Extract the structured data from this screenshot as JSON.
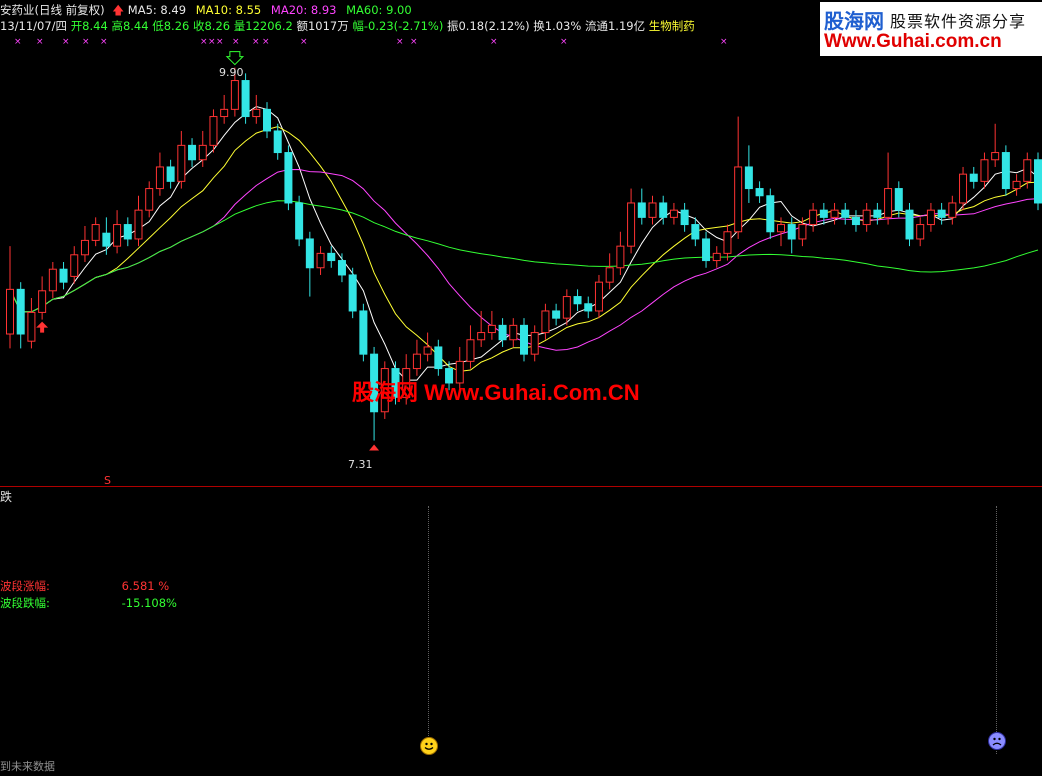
{
  "header": {
    "stock_name": "安药业(日线 前复权)",
    "date": "13/11/07/四",
    "open_label": "开8.44",
    "high_label": "高8.44",
    "low_label": "低8.26",
    "close_label": "收8.26",
    "volume_label": "量12206.2",
    "amount_label": "额1017万",
    "change_label": "幅-0.23(-2.71%)",
    "amplitude_label": "振0.18(2.12%)",
    "turnover_label": "换1.03%",
    "float_label": "流通1.19亿",
    "sector_label": "生物制药",
    "ma5": "MA5: 8.49",
    "ma10": "MA10: 8.55",
    "ma20": "MA20: 8.93",
    "ma60": "MA60: 9.00"
  },
  "logo": {
    "brand": "股海网",
    "slogan": "股票软件资源分享",
    "url": "Www.Guhai.com.cn"
  },
  "watermark": "股海网 Www.Guhai.Com.CN",
  "price_labels": {
    "high": "9.90",
    "low": "7.31"
  },
  "marker_s": "S",
  "indicator": {
    "title": "跌",
    "rise_label": "波段涨幅:",
    "rise_value": "6.581 %",
    "fall_label": "波段跌幅:",
    "fall_value": "-15.108%",
    "footer": "到未来数据"
  },
  "colors": {
    "up": "#ff3333",
    "down": "#33e5e5",
    "ma5": "#ffffff",
    "ma10": "#ffff33",
    "ma20": "#ff44ff",
    "ma60": "#33ff33"
  },
  "candles": [
    [
      8.05,
      8.36,
      8.66,
      7.95
    ],
    [
      8.36,
      8.05,
      8.41,
      7.95
    ],
    [
      8.0,
      8.2,
      8.3,
      7.95
    ],
    [
      8.2,
      8.35,
      8.45,
      8.15
    ],
    [
      8.35,
      8.5,
      8.55,
      8.3
    ],
    [
      8.5,
      8.41,
      8.55,
      8.36
    ],
    [
      8.45,
      8.6,
      8.66,
      8.4
    ],
    [
      8.6,
      8.7,
      8.8,
      8.55
    ],
    [
      8.7,
      8.81,
      8.86,
      8.66
    ],
    [
      8.75,
      8.66,
      8.86,
      8.6
    ],
    [
      8.66,
      8.81,
      8.91,
      8.61
    ],
    [
      8.81,
      8.71,
      8.86,
      8.66
    ],
    [
      8.71,
      8.91,
      9.01,
      8.66
    ],
    [
      8.91,
      9.06,
      9.11,
      8.86
    ],
    [
      9.06,
      9.21,
      9.31,
      9.01
    ],
    [
      9.21,
      9.11,
      9.26,
      9.06
    ],
    [
      9.11,
      9.36,
      9.46,
      9.06
    ],
    [
      9.36,
      9.26,
      9.41,
      9.21
    ],
    [
      9.26,
      9.36,
      9.46,
      9.21
    ],
    [
      9.36,
      9.56,
      9.61,
      9.31
    ],
    [
      9.56,
      9.61,
      9.71,
      9.51
    ],
    [
      9.61,
      9.81,
      9.9,
      9.56
    ],
    [
      9.81,
      9.56,
      9.86,
      9.51
    ],
    [
      9.56,
      9.61,
      9.71,
      9.51
    ],
    [
      9.61,
      9.46,
      9.66,
      9.41
    ],
    [
      9.46,
      9.31,
      9.51,
      9.26
    ],
    [
      9.31,
      8.96,
      9.36,
      8.91
    ],
    [
      8.96,
      8.71,
      9.01,
      8.66
    ],
    [
      8.71,
      8.51,
      8.76,
      8.31
    ],
    [
      8.51,
      8.61,
      8.66,
      8.46
    ],
    [
      8.61,
      8.56,
      8.66,
      8.51
    ],
    [
      8.56,
      8.46,
      8.61,
      8.41
    ],
    [
      8.46,
      8.21,
      8.51,
      8.16
    ],
    [
      8.21,
      7.91,
      8.26,
      7.86
    ],
    [
      7.91,
      7.51,
      7.96,
      7.31
    ],
    [
      7.51,
      7.81,
      7.86,
      7.46
    ],
    [
      7.81,
      7.61,
      7.86,
      7.56
    ],
    [
      7.61,
      7.81,
      7.91,
      7.56
    ],
    [
      7.81,
      7.91,
      8.01,
      7.76
    ],
    [
      7.91,
      7.96,
      8.06,
      7.86
    ],
    [
      7.96,
      7.81,
      8.01,
      7.76
    ],
    [
      7.81,
      7.71,
      7.86,
      7.66
    ],
    [
      7.71,
      7.86,
      7.96,
      7.66
    ],
    [
      7.86,
      8.01,
      8.11,
      7.81
    ],
    [
      8.01,
      8.06,
      8.21,
      7.96
    ],
    [
      8.06,
      8.11,
      8.21,
      8.01
    ],
    [
      8.11,
      8.01,
      8.16,
      7.96
    ],
    [
      8.01,
      8.11,
      8.16,
      7.96
    ],
    [
      8.11,
      7.91,
      8.16,
      7.86
    ],
    [
      7.91,
      8.06,
      8.11,
      7.86
    ],
    [
      8.06,
      8.21,
      8.26,
      8.01
    ],
    [
      8.21,
      8.16,
      8.26,
      8.11
    ],
    [
      8.16,
      8.31,
      8.36,
      8.11
    ],
    [
      8.31,
      8.26,
      8.36,
      8.21
    ],
    [
      8.26,
      8.21,
      8.31,
      8.16
    ],
    [
      8.21,
      8.41,
      8.46,
      8.16
    ],
    [
      8.41,
      8.51,
      8.61,
      8.36
    ],
    [
      8.51,
      8.66,
      8.76,
      8.46
    ],
    [
      8.66,
      8.96,
      9.06,
      8.61
    ],
    [
      8.96,
      8.86,
      9.06,
      8.81
    ],
    [
      8.86,
      8.96,
      9.01,
      8.81
    ],
    [
      8.96,
      8.86,
      9.01,
      8.81
    ],
    [
      8.86,
      8.91,
      8.96,
      8.81
    ],
    [
      8.91,
      8.81,
      8.96,
      8.76
    ],
    [
      8.81,
      8.71,
      8.86,
      8.66
    ],
    [
      8.71,
      8.56,
      8.76,
      8.51
    ],
    [
      8.56,
      8.61,
      8.66,
      8.51
    ],
    [
      8.61,
      8.76,
      8.81,
      8.56
    ],
    [
      8.76,
      9.21,
      9.56,
      8.71
    ],
    [
      9.21,
      9.06,
      9.36,
      8.96
    ],
    [
      9.06,
      9.01,
      9.11,
      8.96
    ],
    [
      9.01,
      8.76,
      9.06,
      8.71
    ],
    [
      8.76,
      8.81,
      8.86,
      8.66
    ],
    [
      8.81,
      8.71,
      8.86,
      8.61
    ],
    [
      8.71,
      8.81,
      8.86,
      8.66
    ],
    [
      8.81,
      8.91,
      8.96,
      8.76
    ],
    [
      8.91,
      8.86,
      8.96,
      8.81
    ],
    [
      8.86,
      8.91,
      8.96,
      8.81
    ],
    [
      8.91,
      8.86,
      8.96,
      8.81
    ],
    [
      8.86,
      8.81,
      8.91,
      8.76
    ],
    [
      8.81,
      8.91,
      8.96,
      8.76
    ],
    [
      8.91,
      8.86,
      8.96,
      8.81
    ],
    [
      8.86,
      9.06,
      9.31,
      8.81
    ],
    [
      9.06,
      8.91,
      9.11,
      8.86
    ],
    [
      8.91,
      8.71,
      8.96,
      8.66
    ],
    [
      8.71,
      8.81,
      8.86,
      8.66
    ],
    [
      8.81,
      8.91,
      8.96,
      8.76
    ],
    [
      8.91,
      8.86,
      8.96,
      8.81
    ],
    [
      8.86,
      8.96,
      9.01,
      8.81
    ],
    [
      8.96,
      9.16,
      9.21,
      8.91
    ],
    [
      9.16,
      9.11,
      9.21,
      9.06
    ],
    [
      9.11,
      9.26,
      9.31,
      9.06
    ],
    [
      9.26,
      9.31,
      9.51,
      9.21
    ],
    [
      9.31,
      9.06,
      9.36,
      9.01
    ],
    [
      9.06,
      9.11,
      9.16,
      9.01
    ],
    [
      9.11,
      9.26,
      9.31,
      9.06
    ],
    [
      9.26,
      8.96,
      9.31,
      8.91
    ]
  ]
}
